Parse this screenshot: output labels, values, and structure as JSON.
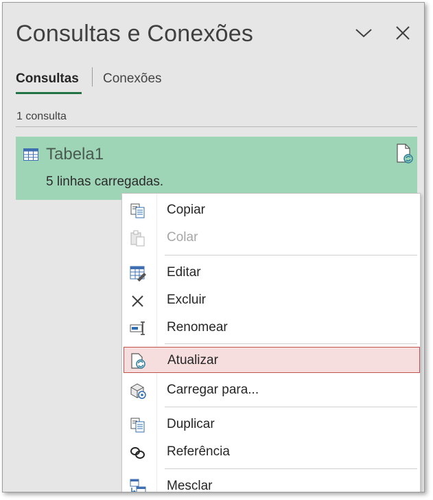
{
  "pane": {
    "title": "Consultas e Conexões",
    "collapse_icon": "chevron-down-icon",
    "close_icon": "close-icon"
  },
  "tabs": [
    {
      "label": "Consultas",
      "active": true
    },
    {
      "label": "Conexões",
      "active": false
    }
  ],
  "query_count": "1 consulta",
  "query": {
    "name": "Tabela1",
    "status": "5 linhas carregadas.",
    "icon": "table-icon",
    "refresh_icon": "document-refresh-icon"
  },
  "context_menu": {
    "items": [
      {
        "label": "Copiar",
        "icon": "copy-icon",
        "enabled": true
      },
      {
        "label": "Colar",
        "icon": "paste-icon",
        "enabled": false
      },
      {
        "label": "Editar",
        "icon": "edit-table-icon",
        "enabled": true
      },
      {
        "label": "Excluir",
        "icon": "delete-x-icon",
        "enabled": true
      },
      {
        "label": "Renomear",
        "icon": "rename-icon",
        "enabled": true
      },
      {
        "label": "Atualizar",
        "icon": "refresh-icon",
        "enabled": true,
        "highlighted": true
      },
      {
        "label": "Carregar para...",
        "icon": "load-to-icon",
        "enabled": true
      },
      {
        "label": "Duplicar",
        "icon": "duplicate-icon",
        "enabled": true
      },
      {
        "label": "Referência",
        "icon": "reference-link-icon",
        "enabled": true
      },
      {
        "label": "Mesclar",
        "icon": "merge-icon",
        "enabled": true
      }
    ]
  },
  "colors": {
    "accent_green": "#217346",
    "selected_query_bg": "#9fd5b7",
    "highlight_border": "#c0504d",
    "highlight_fill": "#f6dede"
  }
}
